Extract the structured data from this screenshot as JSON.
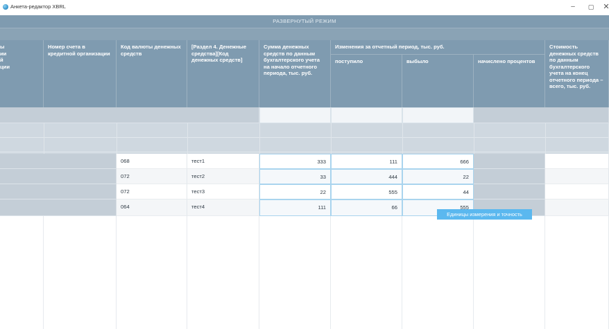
{
  "window": {
    "title": "Анкета-редактор XBRL",
    "controls": {
      "minimize": "–",
      "maximize": "▢",
      "close": "✕"
    }
  },
  "mode_banner": "РАЗВЕРНУТЫЙ РЕЖИМ",
  "table": {
    "headers": {
      "col0": "ы\nии\nй\nции",
      "account": "Номер счета в кредитной организации",
      "currency_code": "Код валюты денежных средств",
      "section_code": "[Раздел 4. Денежные средства][Код денежных средств]",
      "start_balance": "Сумма денежных средств по данным бухгалтерского учета на начало отчетного периода, тыс. руб.",
      "changes_group": "Изменения за отчетный период, тыс. руб.",
      "received": "поступило",
      "withdrawn": "выбыло",
      "interest": "начислено процентов",
      "end_balance": "Стоимость денежных средств по данным бухгалтерского учета на конец отчетного периода – всего, тыс. руб."
    },
    "rows": [
      {
        "currency_code": "068",
        "section_code": "тест1",
        "start_balance": "333",
        "received": "111",
        "withdrawn": "666"
      },
      {
        "currency_code": "072",
        "section_code": "тест2",
        "start_balance": "33",
        "received": "444",
        "withdrawn": "22"
      },
      {
        "currency_code": "072",
        "section_code": "тест3",
        "start_balance": "22",
        "received": "555",
        "withdrawn": "44"
      },
      {
        "currency_code": "064",
        "section_code": "тест4",
        "start_balance": "111",
        "received": "66",
        "withdrawn": "555"
      }
    ]
  },
  "tooltip": "Единицы измерения и точность",
  "colors": {
    "header_bg": "#7f9bb0",
    "tooltip_bg": "#5bb8ef",
    "editable_border": "#a9d4ee"
  }
}
